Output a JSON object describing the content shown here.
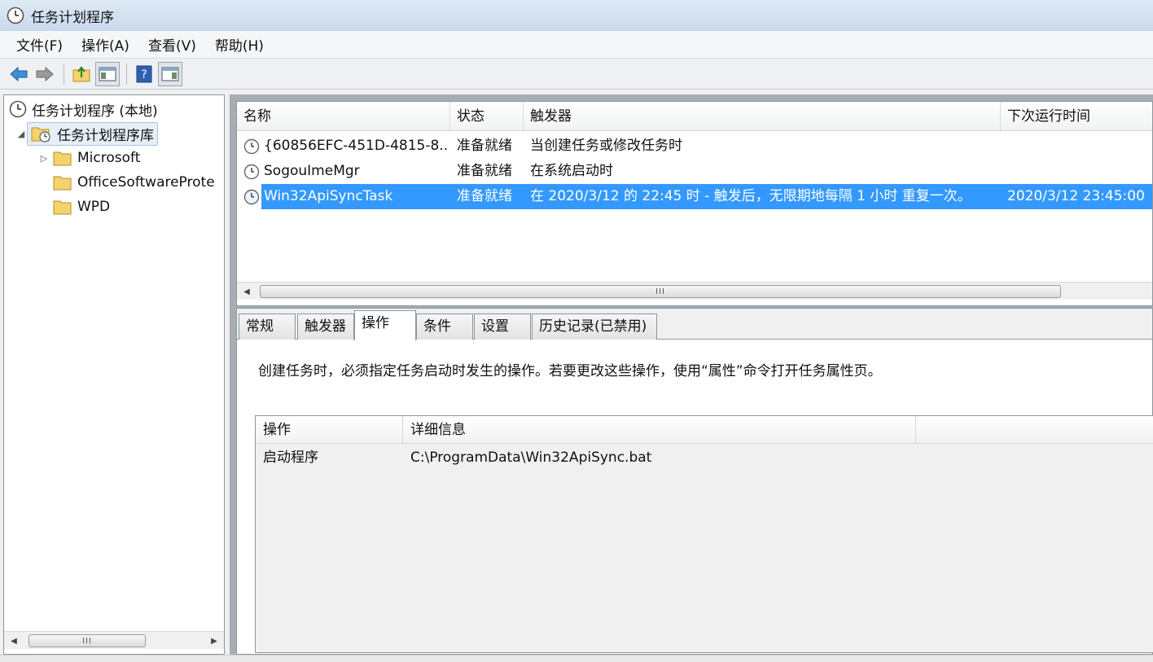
{
  "window": {
    "title": "任务计划程序"
  },
  "menu": {
    "items": [
      {
        "label": "文件(F)"
      },
      {
        "label": "操作(A)"
      },
      {
        "label": "查看(V)"
      },
      {
        "label": "帮助(H)"
      }
    ]
  },
  "toolbar": {
    "buttons": [
      "back-icon",
      "forward-icon",
      "up-folder-icon",
      "show-hide-console-tree-icon",
      "help-icon",
      "show-hide-action-pane-icon"
    ]
  },
  "tree": {
    "root": "任务计划程序 (本地)",
    "library": "任务计划程序库",
    "children": [
      {
        "label": "Microsoft",
        "expandable": true
      },
      {
        "label": "OfficeSoftwareProte",
        "expandable": false
      },
      {
        "label": "WPD",
        "expandable": false
      }
    ]
  },
  "task_list": {
    "columns": [
      "名称",
      "状态",
      "触发器",
      "下次运行时间"
    ],
    "rows": [
      {
        "name": "{60856EFC-451D-4815-8...",
        "status": "准备就绪",
        "trigger": "当创建任务或修改任务时",
        "next_run": "",
        "selected": false
      },
      {
        "name": "SogouImeMgr",
        "status": "准备就绪",
        "trigger": "在系统启动时",
        "next_run": "",
        "selected": false
      },
      {
        "name": "Win32ApiSyncTask",
        "status": "准备就绪",
        "trigger": "在 2020/3/12 的 22:45 时 - 触发后，无限期地每隔 1 小时 重复一次。",
        "next_run": "2020/3/12 23:45:00",
        "selected": true
      }
    ]
  },
  "scroll": {
    "thumb_label": "III"
  },
  "detail": {
    "tabs": [
      {
        "label": "常规",
        "active": false
      },
      {
        "label": "触发器",
        "active": false
      },
      {
        "label": "操作",
        "active": true
      },
      {
        "label": "条件",
        "active": false
      },
      {
        "label": "设置",
        "active": false
      },
      {
        "label": "历史记录(已禁用)",
        "active": false
      }
    ],
    "description": "创建任务时，必须指定任务启动时发生的操作。若要更改这些操作，使用“属性”命令打开任务属性页。",
    "actions_table": {
      "columns": [
        "操作",
        "详细信息"
      ],
      "rows": [
        {
          "action": "启动程序",
          "details": "C:\\ProgramData\\Win32ApiSync.bat"
        }
      ]
    }
  },
  "colors": {
    "selection": "#3399ff",
    "titlebar": "#c9d9ee"
  }
}
